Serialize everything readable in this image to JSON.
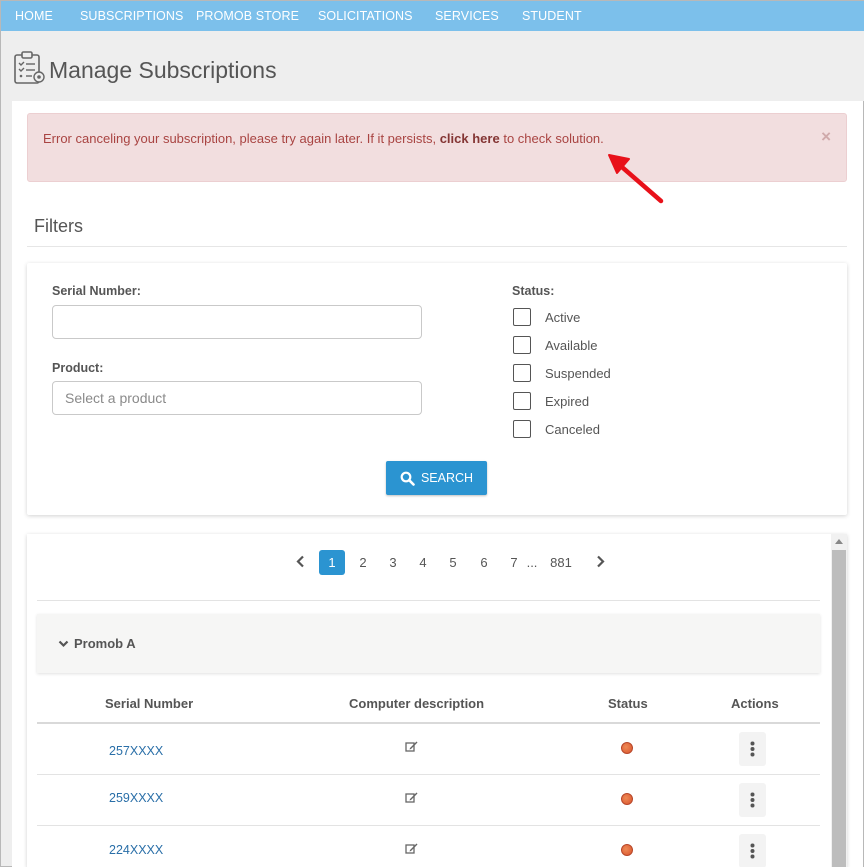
{
  "nav": {
    "items": [
      "HOME",
      "SUBSCRIPTIONS",
      "PROMOB STORE",
      "SOLICITATIONS",
      "SERVICES",
      "STUDENT"
    ]
  },
  "header": {
    "title": "Manage Subscriptions",
    "icon": "clipboard-checklist-icon"
  },
  "alert": {
    "text_before": "Error canceling your subscription, please try again later. If it persists,",
    "link_text": "click here",
    "text_after": "to check solution.",
    "close": "×",
    "color": "#a94442",
    "background": "#f2dedf"
  },
  "filters": {
    "title": "Filters",
    "serial_label": "Serial Number:",
    "serial_value": "",
    "product_label": "Product:",
    "product_placeholder": "Select a product",
    "status_label": "Status:",
    "statuses": [
      {
        "label": "Active",
        "checked": false
      },
      {
        "label": "Available",
        "checked": false
      },
      {
        "label": "Suspended",
        "checked": false
      },
      {
        "label": "Expired",
        "checked": false
      },
      {
        "label": "Canceled",
        "checked": false
      }
    ],
    "search_label": "SEARCH"
  },
  "pagination": {
    "pages": [
      "1",
      "2",
      "3",
      "4",
      "5",
      "6",
      "7"
    ],
    "ellipsis": "...",
    "last": "881",
    "current": "1"
  },
  "group": {
    "label": "Promob A"
  },
  "table": {
    "headers": [
      "Serial Number",
      "Computer description",
      "Status",
      "Actions"
    ],
    "rows": [
      {
        "serial": "257XXXX",
        "status_color": "#d9532d"
      },
      {
        "serial": "259XXXX",
        "status_color": "#d9532d"
      },
      {
        "serial": "224XXXX",
        "status_color": "#d9532d"
      }
    ]
  },
  "colors": {
    "nav": "#7cc0eb",
    "accent": "#2b94d1",
    "link": "#2a6fa8"
  }
}
